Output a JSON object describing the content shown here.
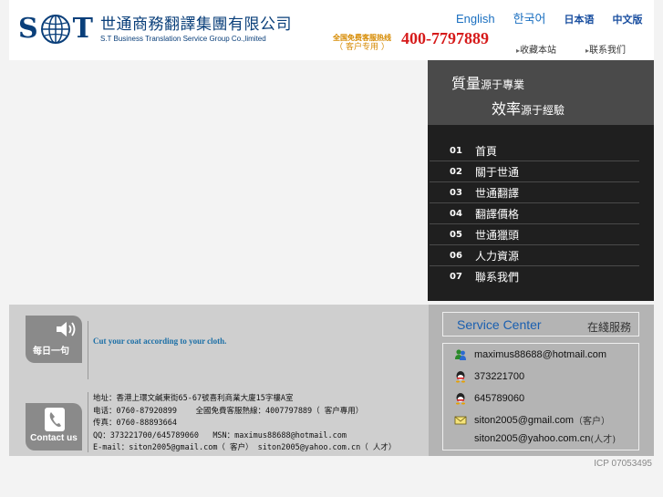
{
  "header": {
    "logo_letter_left": "S",
    "logo_letter_right": "T",
    "company_cn": "世通商務翻譯集團有限公司",
    "company_en": "S.T Business Translation Service Group Co.,limited",
    "hotline_label": "全国免费客服热线",
    "hotline_label2": "（ 客户专用 ）",
    "hotline_number": "400-7797889",
    "languages": [
      "English",
      "한국어",
      "日本语",
      "中文版"
    ],
    "links": [
      "收藏本站",
      "联系我们"
    ]
  },
  "slogan": {
    "line1_big": "質量",
    "line1_small": "源于專業",
    "line2_big": "效率",
    "line2_small": "源于經驗"
  },
  "menu": [
    {
      "num": "01",
      "label": "首頁"
    },
    {
      "num": "02",
      "label": "關于世通"
    },
    {
      "num": "03",
      "label": "世通翻譯"
    },
    {
      "num": "04",
      "label": "翻譯價格"
    },
    {
      "num": "05",
      "label": "世通獵頭"
    },
    {
      "num": "06",
      "label": "人力資源"
    },
    {
      "num": "07",
      "label": "聯系我們"
    }
  ],
  "daily": {
    "label": "每日一句",
    "quote": "Cut your coat according to your cloth."
  },
  "contact": {
    "label": "Contact us",
    "address": "地址：香港上環文鹹東街65-67號喜利商業大廈15字樓A室\n电话：0760-87920899    全國免費客服熱線：4007797889（ 客户專用）\n传真：0760-88893664\nQQ：373221700/645789060   MSN：maximus88688@hotmail.com\nE-mail：siton2005@gmail.com（ 客户） siton2005@yahoo.com.cn（ 人才）"
  },
  "service_center": {
    "title": "Service Center",
    "subtitle": "在綫服務",
    "rows": [
      {
        "icon": "msn-icon",
        "text": "maximus88688@hotmail.com",
        "note": ""
      },
      {
        "icon": "qq-icon",
        "text": "373221700",
        "note": ""
      },
      {
        "icon": "qq-icon",
        "text": "645789060",
        "note": ""
      },
      {
        "icon": "mail-icon",
        "text": "siton2005@gmail.com",
        "note": "（客户）"
      },
      {
        "icon": "",
        "text": "siton2005@yahoo.com.cn",
        "note": "(人才)"
      }
    ]
  },
  "footer": {
    "icp": "ICP 07053495"
  },
  "colors": {
    "brand_blue": "#0a3f7a",
    "hotline_red": "#d61a1a",
    "link_blue": "#1a6fc0",
    "menu_bg": "#1f1f1f",
    "slogan_bg": "#4a4a4a"
  }
}
